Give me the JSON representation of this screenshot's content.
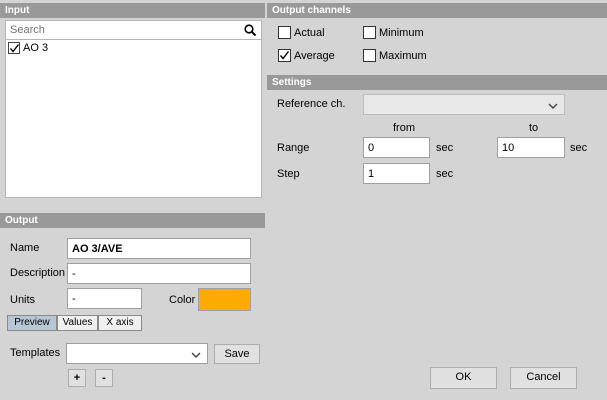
{
  "input": {
    "header": "Input",
    "search_placeholder": "Search",
    "items": [
      {
        "label": "AO 3",
        "checked": true
      }
    ]
  },
  "output_channels": {
    "header": "Output channels",
    "actual_label": "Actual",
    "actual_checked": false,
    "minimum_label": "Minimum",
    "minimum_checked": false,
    "average_label": "Average",
    "average_checked": true,
    "maximum_label": "Maximum",
    "maximum_checked": false
  },
  "settings": {
    "header": "Settings",
    "reference_label": "Reference ch.",
    "reference_value": "",
    "from_label": "from",
    "to_label": "to",
    "range_label": "Range",
    "range_from": "0",
    "range_to": "10",
    "step_label": "Step",
    "step_value": "1",
    "unit": "sec"
  },
  "output": {
    "header": "Output",
    "name_label": "Name",
    "name_value": "AO 3/AVE",
    "description_label": "Description",
    "description_value": "-",
    "units_label": "Units",
    "units_value": "-",
    "color_label": "Color",
    "color_value": "#ffaa00"
  },
  "tabs": [
    {
      "label": "Preview",
      "active": true
    },
    {
      "label": "Values",
      "active": false
    },
    {
      "label": "X axis",
      "active": false
    }
  ],
  "templates": {
    "label": "Templates",
    "value": "",
    "save_label": "Save",
    "add_label": "+",
    "remove_label": "-"
  },
  "dialog": {
    "ok_label": "OK",
    "cancel_label": "Cancel"
  },
  "colors": {
    "header_bg": "#999999",
    "active_tab": "#b8c7d6"
  }
}
